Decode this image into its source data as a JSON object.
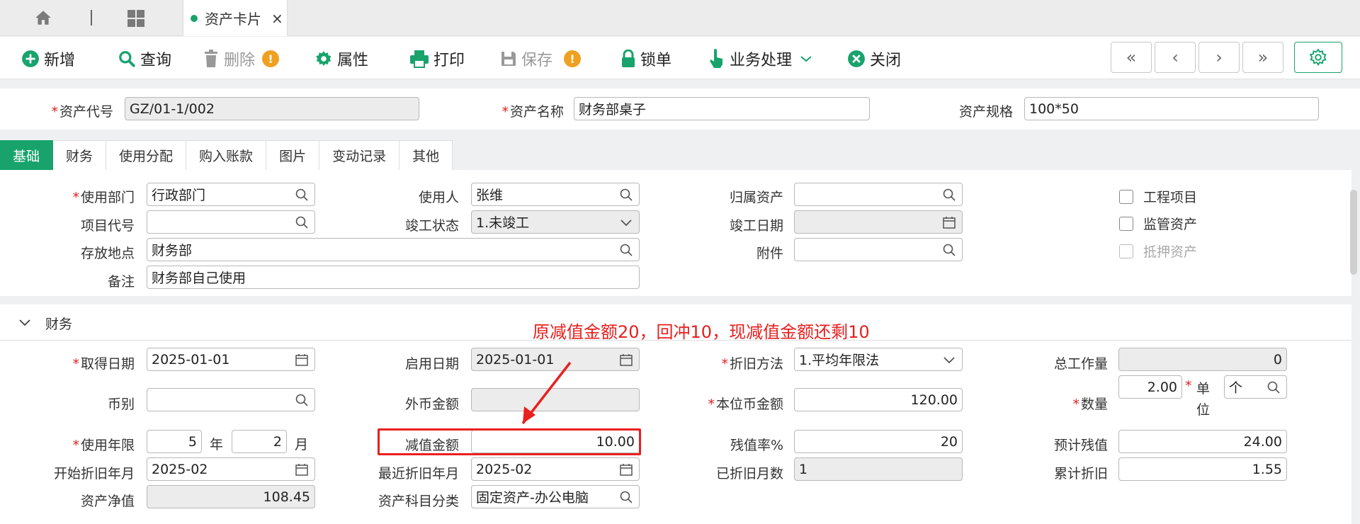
{
  "tabbar": {
    "doc_tab": "资产卡片",
    "close": "×"
  },
  "toolbar": {
    "add": "新增",
    "query": "查询",
    "delete": "删除",
    "props": "属性",
    "print": "打印",
    "save": "保存",
    "lock": "锁单",
    "business": "业务处理",
    "close": "关闭",
    "warn": "!",
    "nav_first": "«",
    "nav_prev": "‹",
    "nav_next": "›",
    "nav_last": "»"
  },
  "header": {
    "asset_code_label": "资产代号",
    "asset_code": "GZ/01-1/002",
    "asset_name_label": "资产名称",
    "asset_name": "财务部桌子",
    "asset_spec_label": "资产规格",
    "asset_spec": "100*50"
  },
  "subtabs": [
    "基础",
    "财务",
    "使用分配",
    "购入账款",
    "图片",
    "变动记录",
    "其他"
  ],
  "basic": {
    "use_dept_label": "使用部门",
    "use_dept": "行政部门",
    "user_label": "使用人",
    "user": "张维",
    "owner_asset_label": "归属资产",
    "owner_asset": "",
    "project_code_label": "项目代号",
    "project_code": "",
    "completion_status_label": "竣工状态",
    "completion_status": "1.未竣工",
    "completion_date_label": "竣工日期",
    "completion_date": "",
    "location_label": "存放地点",
    "location": "财务部",
    "attachment_label": "附件",
    "attachment": "",
    "remark_label": "备注",
    "remark": "财务部自己使用",
    "chk_project": "工程项目",
    "chk_supervised": "监管资产",
    "chk_mortgage": "抵押资产"
  },
  "finance": {
    "section_title": "财务",
    "annotation": "原减值金额20，回冲10，现减值金额还剩10",
    "acq_date_label": "取得日期",
    "acq_date": "2025-01-01",
    "start_date_label": "启用日期",
    "start_date": "2025-01-01",
    "dep_method_label": "折旧方法",
    "dep_method": "1.平均年限法",
    "total_work_label": "总工作量",
    "total_work": "0",
    "currency_label": "币别",
    "currency": "",
    "foreign_amount_label": "外币金额",
    "foreign_amount": "",
    "local_amount_label": "本位币金额",
    "local_amount": "120.00",
    "quantity_label": "数量",
    "quantity": "2.00",
    "unit_label": "单位",
    "unit": "个",
    "life_label": "使用年限",
    "life_years": "5",
    "year_unit": "年",
    "life_months": "2",
    "month_unit": "月",
    "impairment_label": "减值金额",
    "impairment": "10.00",
    "residual_rate_label": "残值率%",
    "residual_rate": "20",
    "est_residual_label": "预计残值",
    "est_residual": "24.00",
    "dep_start_label": "开始折旧年月",
    "dep_start": "2025-02",
    "last_dep_label": "最近折旧年月",
    "last_dep": "2025-02",
    "dep_months_label": "已折旧月数",
    "dep_months": "1",
    "accum_dep_label": "累计折旧",
    "accum_dep": "1.55",
    "net_value_label": "资产净值",
    "net_value": "108.45",
    "asset_category_label": "资产科目分类",
    "asset_category": "固定资产-办公电脑"
  },
  "colors": {
    "accent": "#18a36c",
    "required": "#e02020",
    "annotation": "#e8201e"
  }
}
